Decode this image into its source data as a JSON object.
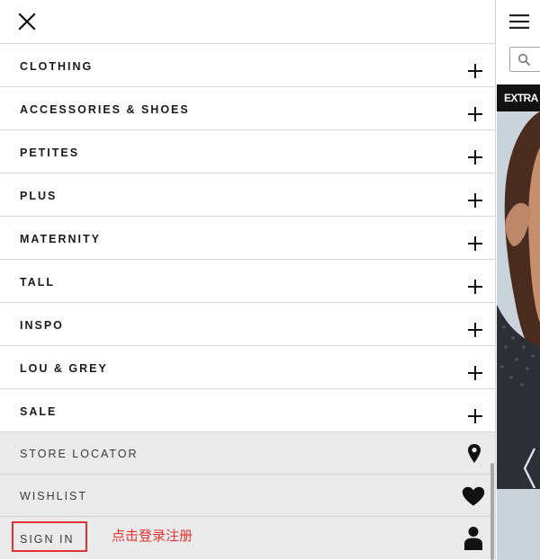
{
  "drawer": {
    "close_icon": "close-icon",
    "categories": [
      {
        "label": "CLOTHING",
        "icon": "plus-icon"
      },
      {
        "label": "ACCESSORIES & SHOES",
        "icon": "plus-icon"
      },
      {
        "label": "PETITES",
        "icon": "plus-icon"
      },
      {
        "label": "PLUS",
        "icon": "plus-icon"
      },
      {
        "label": "MATERNITY",
        "icon": "plus-icon"
      },
      {
        "label": "TALL",
        "icon": "plus-icon"
      },
      {
        "label": "INSPO",
        "icon": "plus-icon"
      },
      {
        "label": "LOU & GREY",
        "icon": "plus-icon"
      },
      {
        "label": "SALE",
        "icon": "plus-icon"
      }
    ],
    "utilities": {
      "store_locator": {
        "label": "STORE LOCATOR",
        "icon": "location-pin-icon"
      },
      "wishlist": {
        "label": "WISHLIST",
        "icon": "heart-icon"
      },
      "sign_in": {
        "label": "SIGN IN",
        "icon": "person-icon"
      }
    },
    "annotation": "点击登录注册"
  },
  "background_page": {
    "menu_icon": "hamburger-icon",
    "search_icon": "search-icon",
    "promo_text": "EXTRA"
  },
  "colors": {
    "utility_background": "#ebebeb",
    "annotation_red": "#e03232",
    "divider": "#d6d6d6",
    "promo_banner": "#111111"
  }
}
